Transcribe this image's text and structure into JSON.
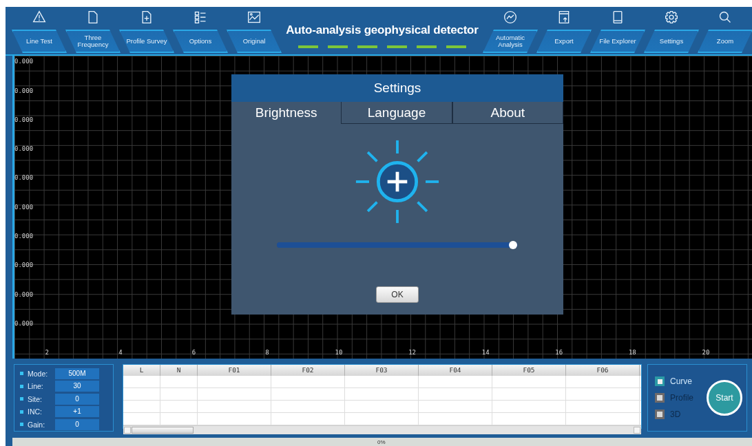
{
  "window": {
    "title": "Auto-analysis geophysical detector"
  },
  "toolbar": {
    "left_tabs": [
      {
        "label": "Line Test"
      },
      {
        "label": "Three Frequency"
      },
      {
        "label": "Profile Survey"
      },
      {
        "label": "Options"
      },
      {
        "label": "Original"
      }
    ],
    "right_tabs": [
      {
        "label": "Automatic Analysis"
      },
      {
        "label": "Export"
      },
      {
        "label": "File Explorer"
      },
      {
        "label": "Settings"
      },
      {
        "label": "Zoom"
      }
    ]
  },
  "plot": {
    "y_labels": [
      "0.000",
      "0.000",
      "0.000",
      "0.000",
      "0.000",
      "0.000",
      "0.000",
      "0.000",
      "0.000",
      "0.000"
    ],
    "x_labels": [
      "2",
      "4",
      "6",
      "8",
      "10",
      "12",
      "14",
      "16",
      "18",
      "20"
    ]
  },
  "dialog": {
    "title": "Settings",
    "tabs": [
      {
        "label": "Brightness",
        "selected": true
      },
      {
        "label": "Language",
        "selected": false
      },
      {
        "label": "About",
        "selected": false
      }
    ],
    "brightness": {
      "level": 0.98
    },
    "ok_button": "OK"
  },
  "info_panel": [
    {
      "label": "Mode:",
      "value": "500M"
    },
    {
      "label": "Line:",
      "value": "30"
    },
    {
      "label": "Site:",
      "value": "0"
    },
    {
      "label": "INC:",
      "value": "+1"
    },
    {
      "label": "Gain:",
      "value": "0"
    }
  ],
  "table": {
    "columns": [
      "L",
      "N",
      "F01",
      "F02",
      "F03",
      "F04",
      "F05",
      "F06"
    ]
  },
  "display_options": [
    {
      "label": "Curve",
      "checked": true
    },
    {
      "label": "Profile",
      "checked": false
    },
    {
      "label": "3D",
      "checked": false
    }
  ],
  "start_button": "Start",
  "progress": {
    "level": 0,
    "reading": "0%"
  }
}
